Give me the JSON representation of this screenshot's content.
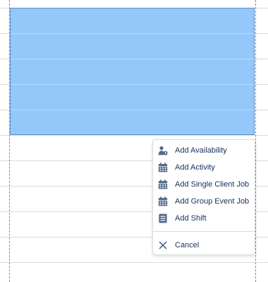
{
  "menu": {
    "items": [
      {
        "label": "Add Availability",
        "icon": "user-clock-icon"
      },
      {
        "label": "Add Activity",
        "icon": "calendar-icon"
      },
      {
        "label": "Add Single Client Job",
        "icon": "calendar-icon"
      },
      {
        "label": "Add Group Event Job",
        "icon": "calendar-icon"
      },
      {
        "label": "Add Shift",
        "icon": "note-icon"
      }
    ],
    "cancel": {
      "label": "Cancel",
      "icon": "close-icon"
    }
  },
  "colors": {
    "selection_fill": "#95c8fa",
    "selection_border": "#5a8fc9",
    "menu_text": "#16325c",
    "icon": "#54698d",
    "grid_line": "#dddbda"
  }
}
